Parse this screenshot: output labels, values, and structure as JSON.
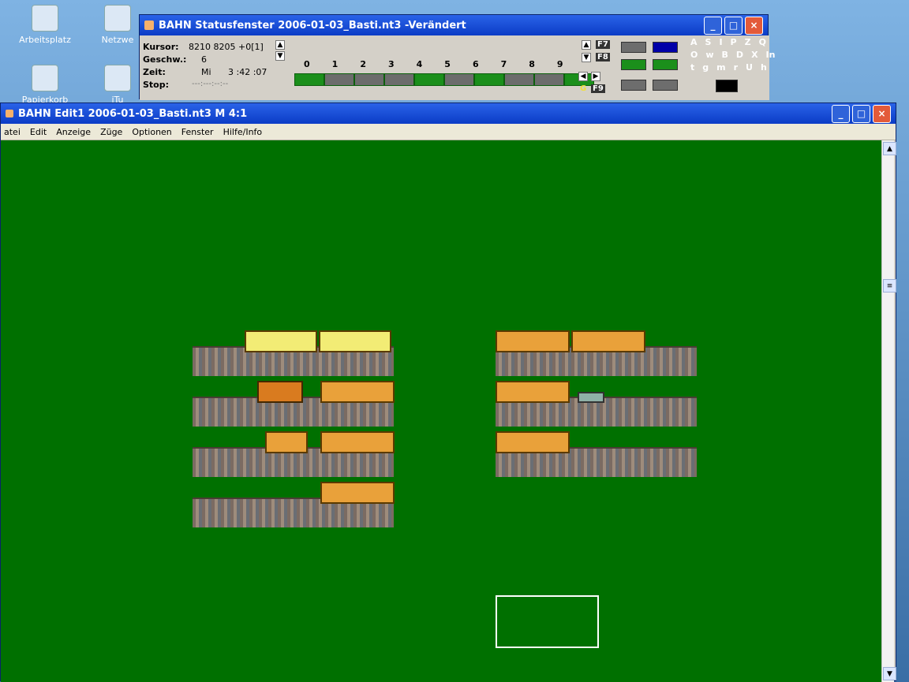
{
  "desktop": {
    "icons": [
      {
        "label": "Arbeitsplatz"
      },
      {
        "label": "Netzwe"
      },
      {
        "label": "Papierkorb"
      },
      {
        "label": "iTu"
      }
    ]
  },
  "status_window": {
    "title": "BAHN Statusfenster 2006-01-03_Basti.nt3 -Verändert",
    "labels": {
      "kursor": "Kursor:",
      "geschw": "Geschw.:",
      "zeit": "Zeit:",
      "stop": "Stop:"
    },
    "values": {
      "kursor": "8210  8205 +0[1]",
      "geschw": "6",
      "zeit_day": "Mi",
      "zeit_time": "3 :42 :07",
      "stop": "---:---:--:--"
    },
    "digits": [
      "0",
      "1",
      "2",
      "3",
      "4",
      "5",
      "6",
      "7",
      "8",
      "9"
    ],
    "f_labels": [
      "F7",
      "F8",
      "F9"
    ],
    "g_label": "G",
    "letters_row1": [
      "A",
      "S",
      "I",
      "P",
      "Z",
      "Q"
    ],
    "letters_row2": [
      "O",
      "w",
      "B",
      "D",
      "X",
      "In"
    ],
    "letters_row3": [
      "t",
      "g",
      "m",
      "r",
      "U",
      "h"
    ]
  },
  "edit_window": {
    "title": "BAHN Edit1 2006-01-03_Basti.nt3 M 4:1",
    "menu": [
      "atei",
      "Edit",
      "Anzeige",
      "Züge",
      "Optionen",
      "Fenster",
      "Hilfe/Info"
    ]
  },
  "colors": {
    "canvas_green": "#007000",
    "xp_blue": "#0b3cc6",
    "train_orange": "#e9a13a",
    "train_yellow": "#f2ec75"
  }
}
